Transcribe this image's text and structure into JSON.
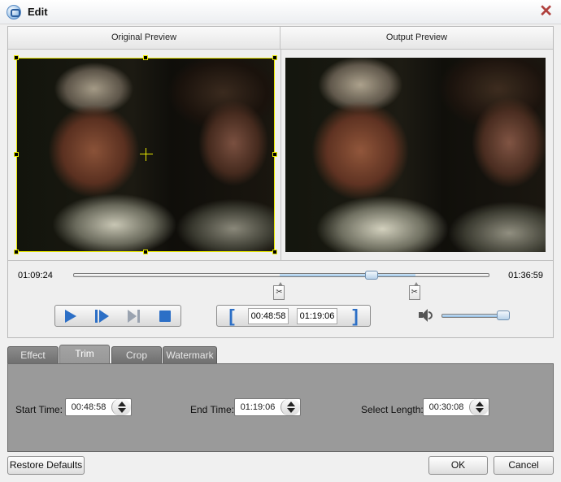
{
  "window": {
    "title": "Edit",
    "icon": "app-icon",
    "close_icon": "close-icon"
  },
  "preview": {
    "original_label": "Original Preview",
    "output_label": "Output Preview"
  },
  "timeline": {
    "current_time": "01:09:24",
    "total_time": "01:36:59",
    "position_fraction": 0.715,
    "trim_start_fraction": 0.495,
    "trim_end_fraction": 0.82
  },
  "playback": {
    "play_icon": "play-icon",
    "step_icon": "next-frame-icon",
    "end_icon": "go-to-end-icon",
    "stop_icon": "stop-icon"
  },
  "trim_controls": {
    "start_bracket": "[",
    "end_bracket": "]",
    "start_time": "00:48:58",
    "end_time": "01:19:06"
  },
  "volume": {
    "icon": "volume-icon",
    "level_fraction": 0.9
  },
  "tabs": [
    {
      "label": "Effect",
      "active": false
    },
    {
      "label": "Trim",
      "active": true
    },
    {
      "label": "Crop",
      "active": false
    },
    {
      "label": "Watermark",
      "active": false
    }
  ],
  "trim": {
    "start_label": "Start Time:",
    "start_value": "00:48:58",
    "end_label": "End Time:",
    "end_value": "01:19:06",
    "length_label": "Select Length:",
    "length_value": "00:30:08"
  },
  "buttons": {
    "restore": "Restore Defaults",
    "ok": "OK",
    "cancel": "Cancel"
  }
}
